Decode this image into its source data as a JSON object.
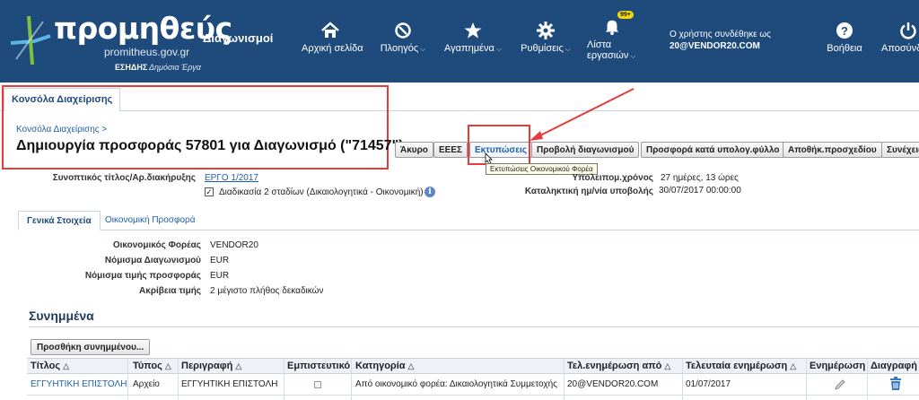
{
  "header": {
    "logo_text": "προμηθεύς",
    "logo_url": "promitheus.gov.gr",
    "logo_esidis": "ΕΣΗΔΗΣ",
    "logo_tagline": "Δημόσια Έργα",
    "app_name": "Διαγωνισμοί",
    "nav": [
      {
        "label": "Αρχική σελίδα",
        "icon": "home-icon"
      },
      {
        "label": "Πλοηγός",
        "icon": "navigator-icon"
      },
      {
        "label": "Αγαπημένα",
        "icon": "star-icon"
      },
      {
        "label": "Ρυθμίσεις",
        "icon": "gear-icon"
      },
      {
        "label": "Λίστα",
        "label2": "εργασιών",
        "icon": "bell-icon",
        "badge": "99+"
      },
      {
        "label": "Βοήθεια",
        "icon": "help-icon"
      },
      {
        "label": "Αποσύνδεση",
        "icon": "power-icon"
      }
    ],
    "user_line1": "Ο χρήστης συνδέθηκε ως",
    "user_line2": "20@VENDOR20.COM",
    "bg_color": "#1f4a7c"
  },
  "console_tab": "Κονσόλα Διαχείρισης",
  "breadcrumb": "Κονσόλα Διαχείρισης  >",
  "page_title": "Δημιουργία προσφοράς 57801 για Διαγωνισμό (\"71457\")",
  "buttons": {
    "cancel": "Άκυρο",
    "eees": "ΕΕΕΣ",
    "prints": "Εκτυπώσεις",
    "view_tender": "Προβολή διαγωνισμού",
    "spreadsheet_offer": "Προσφορά κατά υπολογ.φύλλο",
    "save_draft": "Αποθήκ.προσχεδίου",
    "continue": "Συνέχεια"
  },
  "tooltip": "Εκτυπώσεις Οικονομικού Φορέα",
  "summary": {
    "title_label": "Συνοπτικός τίτλος/Αρ.διακήρυξης",
    "title_value": "ΕΡΓΟ 1/2017",
    "two_stage_label": "Διαδικασία 2 σταδίων (Δικαιολογητικά - Οικονομική)",
    "remaining_label": "Υπολειπομ.χρόνος",
    "remaining_value": "27 ημέρες, 13 ώρες",
    "deadline_label": "Καταληκτική ημ/νία υποβολής",
    "deadline_value": "30/07/2017 00:00:00"
  },
  "subtabs": [
    "Γενικά Στοιχεία",
    "Οικονομική Προσφορά"
  ],
  "general": {
    "rows": [
      {
        "label": "Οικονομικός Φορέας",
        "value": "VENDOR20"
      },
      {
        "label": "Νόμισμα Διαγωνισμού",
        "value": "EUR"
      },
      {
        "label": "Νόμισμα τιμής προσφοράς",
        "value": "EUR"
      },
      {
        "label": "Ακρίβεια τιμής",
        "value": "2 μέγιστο πλήθος δεκαδικών"
      }
    ]
  },
  "attachments": {
    "title": "Συνημμένα",
    "add_button": "Προσθήκη συνημμένου...",
    "columns": [
      "Τίτλος",
      "Τύπος",
      "Περιγραφή",
      "Εμπιστευτικό",
      "Κατηγορία",
      "Τελ.ενημέρωση από",
      "Τελευταία ενημέρωση",
      "Ενημέρωση",
      "Διαγραφή"
    ],
    "rows": [
      {
        "title": "ΕΓΓΥΗΤΙΚΗ ΕΠΙΣΤΟΛΗ",
        "type": "Αρχείο",
        "description": "ΕΓΓΥΗΤΙΚΗ ΕΠΙΣΤΟΛΗ",
        "category": "Από οικονομικό φορέα: Δικαιολογητικά Συμμετοχής",
        "updated_by": "20@VENDOR20.COM",
        "updated_on": "01/07/2017"
      }
    ]
  }
}
